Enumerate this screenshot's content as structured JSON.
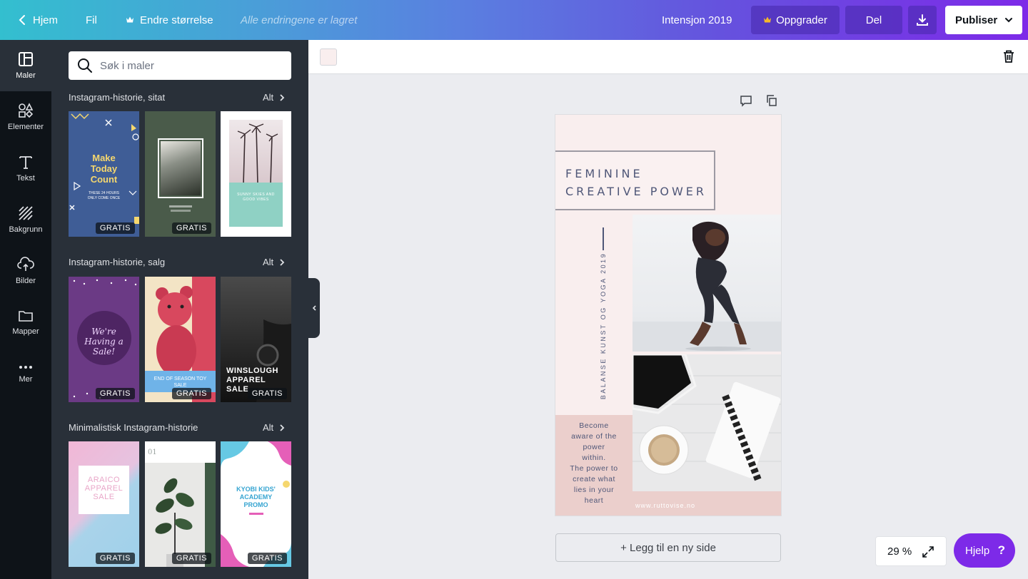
{
  "topbar": {
    "home": "Hjem",
    "file": "Fil",
    "resize": "Endre størrelse",
    "status": "Alle endringene er lagret",
    "doc_title": "Intensjon 2019",
    "upgrade": "Oppgrader",
    "share": "Del",
    "publish": "Publiser"
  },
  "rail": [
    {
      "label": "Maler",
      "icon": "layout-icon"
    },
    {
      "label": "Elementer",
      "icon": "shapes-icon"
    },
    {
      "label": "Tekst",
      "icon": "text-icon"
    },
    {
      "label": "Bakgrunn",
      "icon": "pattern-icon"
    },
    {
      "label": "Bilder",
      "icon": "upload-icon"
    },
    {
      "label": "Mapper",
      "icon": "folder-icon"
    },
    {
      "label": "Mer",
      "icon": "more-icon"
    }
  ],
  "panel": {
    "search_placeholder": "Søk i maler",
    "all_label": "Alt",
    "free_badge": "GRATIS",
    "sections": [
      {
        "title": "Instagram-historie, sitat",
        "thumbs": [
          {
            "text": "Make Today Count",
            "sub": "THESE 24 HOURS ONLY COME ONCE",
            "badge": true
          },
          {
            "text": "",
            "badge": true
          },
          {
            "text": "SUNNY SKIES AND GOOD VIBES",
            "badge": false
          }
        ]
      },
      {
        "title": "Instagram-historie, salg",
        "thumbs": [
          {
            "text": "We're Having a Sale!",
            "badge": true
          },
          {
            "text": "END OF SEASON TOY SALE",
            "badge": true
          },
          {
            "text": "WINSLOUGH APPAREL SALE",
            "badge": true
          }
        ]
      },
      {
        "title": "Minimalistisk Instagram-historie",
        "thumbs": [
          {
            "text": "ARAICO APPAREL SALE",
            "badge": true
          },
          {
            "text": "01",
            "badge": true
          },
          {
            "text": "KYOBI KIDS' ACADEMY PROMO",
            "badge": true
          }
        ]
      }
    ]
  },
  "canvas": {
    "swatch_color": "#f9eeee",
    "title_line1": "FEMININE",
    "title_line2": "CREATIVE POWER",
    "vertical_text": "BALANSE KUNST OG YOGA 2019",
    "quote": [
      "Become",
      "aware of the",
      "power",
      "within.",
      "The power to",
      "create what",
      "lies in your",
      "heart"
    ],
    "url": "www.ruttovise.no",
    "add_page": "+ Legg til en ny side"
  },
  "zoom": "29 %",
  "help": "Hjelp",
  "help_icon": "?",
  "colors": {
    "accent": "#7d2ae8",
    "dark": "#0e1318",
    "panel": "#293039",
    "title_ink": "#4f5778"
  }
}
